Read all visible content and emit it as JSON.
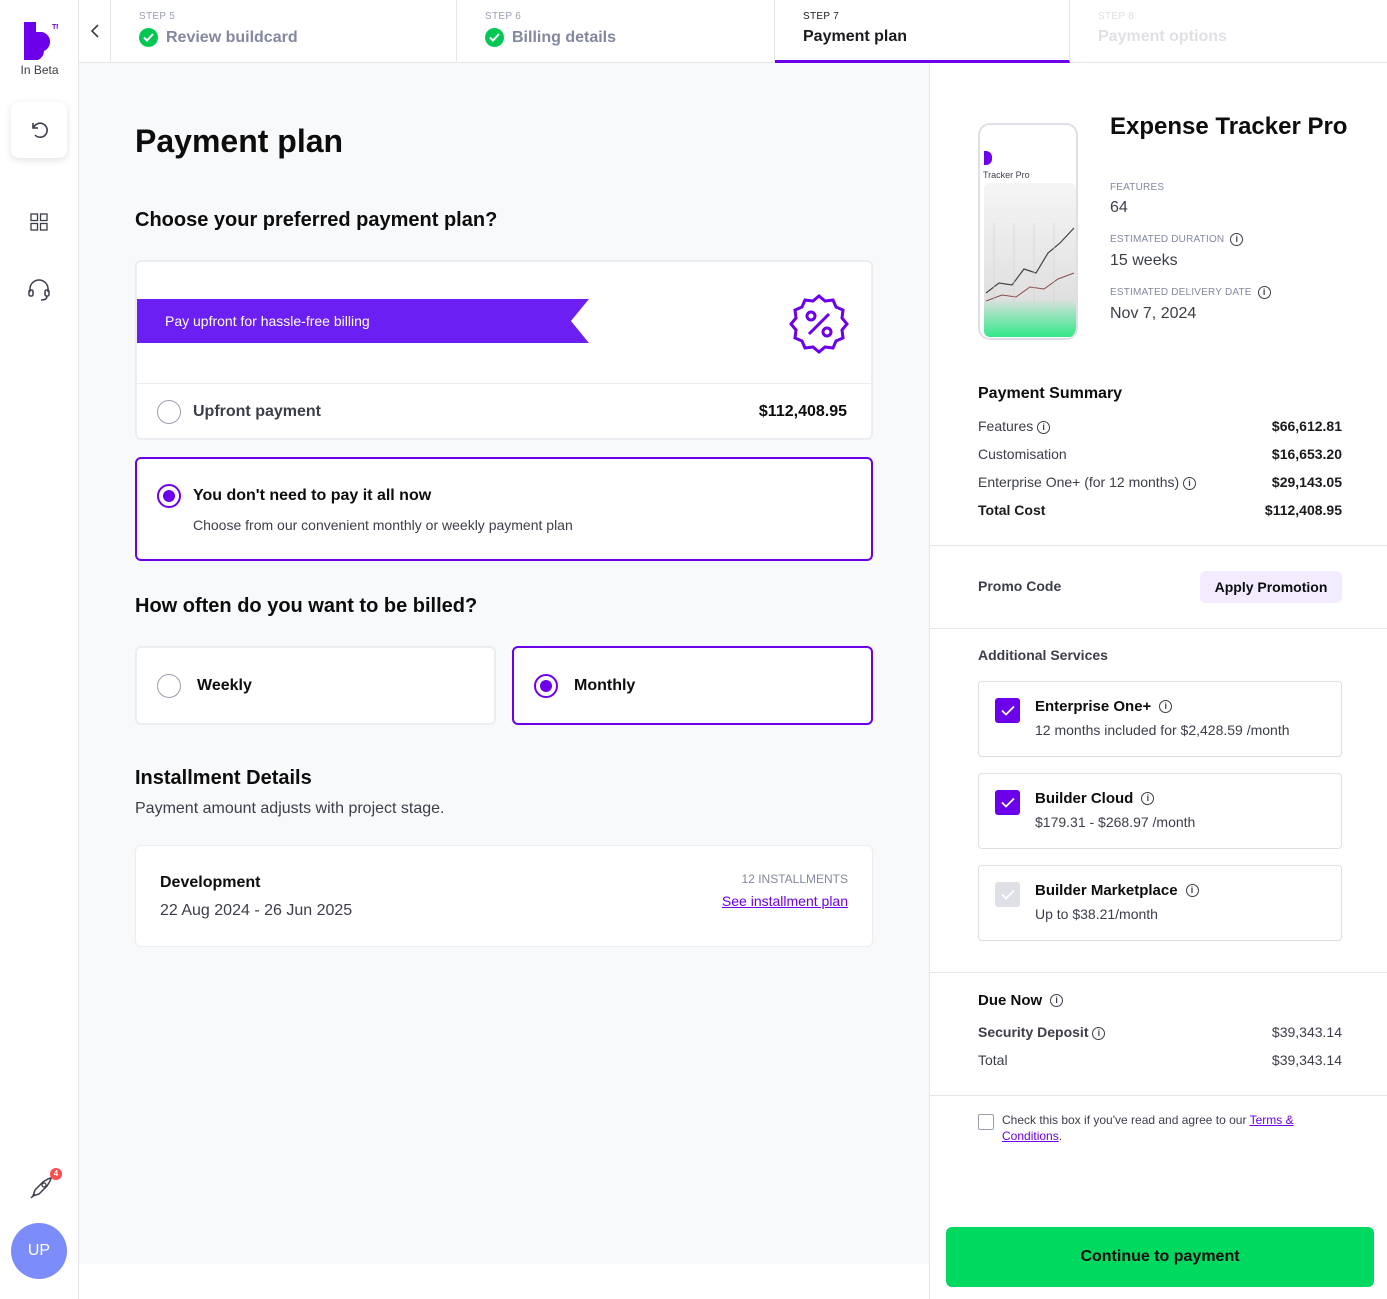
{
  "rail": {
    "beta_label": "In Beta",
    "notification_count": "4",
    "avatar_initials": "UP"
  },
  "stepper": {
    "steps": [
      {
        "num": "STEP 5",
        "label": "Review buildcard",
        "state": "done"
      },
      {
        "num": "STEP 6",
        "label": "Billing details",
        "state": "done"
      },
      {
        "num": "STEP 7",
        "label": "Payment plan",
        "state": "active"
      },
      {
        "num": "STEP 8",
        "label": "Payment options",
        "state": "future"
      }
    ]
  },
  "main": {
    "title": "Payment plan",
    "plan_question": "Choose your preferred payment plan?",
    "upfront_banner": "Pay upfront for hassle-free billing",
    "upfront_label": "Upfront payment",
    "upfront_amount": "$112,408.95",
    "installment_title": "You don't need to pay it all now",
    "installment_sub": "Choose from our convenient monthly or weekly payment plan",
    "billing_question": "How often do you want to be billed?",
    "billing_options": [
      "Weekly",
      "Monthly"
    ],
    "billing_selected": "Monthly",
    "installment_details_title": "Installment Details",
    "installment_details_sub": "Payment amount adjusts with project stage.",
    "stage_name": "Development",
    "stage_dates": "22 Aug 2024 - 26 Jun 2025",
    "installments_count": "12 INSTALLMENTS",
    "installment_plan_link": "See installment plan"
  },
  "side": {
    "app_name": "Expense Tracker Pro",
    "phone_caption": "Tracker Pro",
    "features_label": "FEATURES",
    "features_value": "64",
    "duration_label": "ESTIMATED DURATION",
    "duration_value": "15 weeks",
    "delivery_label": "ESTIMATED DELIVERY DATE",
    "delivery_value": "Nov 7, 2024",
    "summary_title": "Payment Summary",
    "summary_rows": [
      {
        "label": "Features",
        "amount": "$66,612.81"
      },
      {
        "label": "Customisation",
        "amount": "$16,653.20"
      },
      {
        "label": "Enterprise One+ (for 12 months)",
        "amount": "$29,143.05"
      },
      {
        "label": "Total Cost",
        "amount": "$112,408.95"
      }
    ],
    "promo_label": "Promo Code",
    "promo_button": "Apply Promotion",
    "services_title": "Additional Services",
    "services": [
      {
        "name": "Enterprise One+",
        "sub": "12 months included for $2,428.59 /month",
        "checked": true
      },
      {
        "name": "Builder Cloud",
        "sub": "$179.31 - $268.97 /month",
        "checked": true
      },
      {
        "name": "Builder Marketplace",
        "sub": "Up to $38.21/month",
        "checked": false
      }
    ],
    "due_now_title": "Due Now",
    "deposit_label": "Security Deposit",
    "deposit_amount": "$39,343.14",
    "total_label": "Total",
    "total_amount": "$39,343.14",
    "terms_text": "Check this box if you've read and agree to our",
    "terms_link": "Terms & Conditions",
    "terms_end": ".",
    "continue_button": "Continue to payment"
  },
  "colors": {
    "accent": "#6c00ea",
    "success": "#00c853",
    "cta": "#00d95f"
  }
}
